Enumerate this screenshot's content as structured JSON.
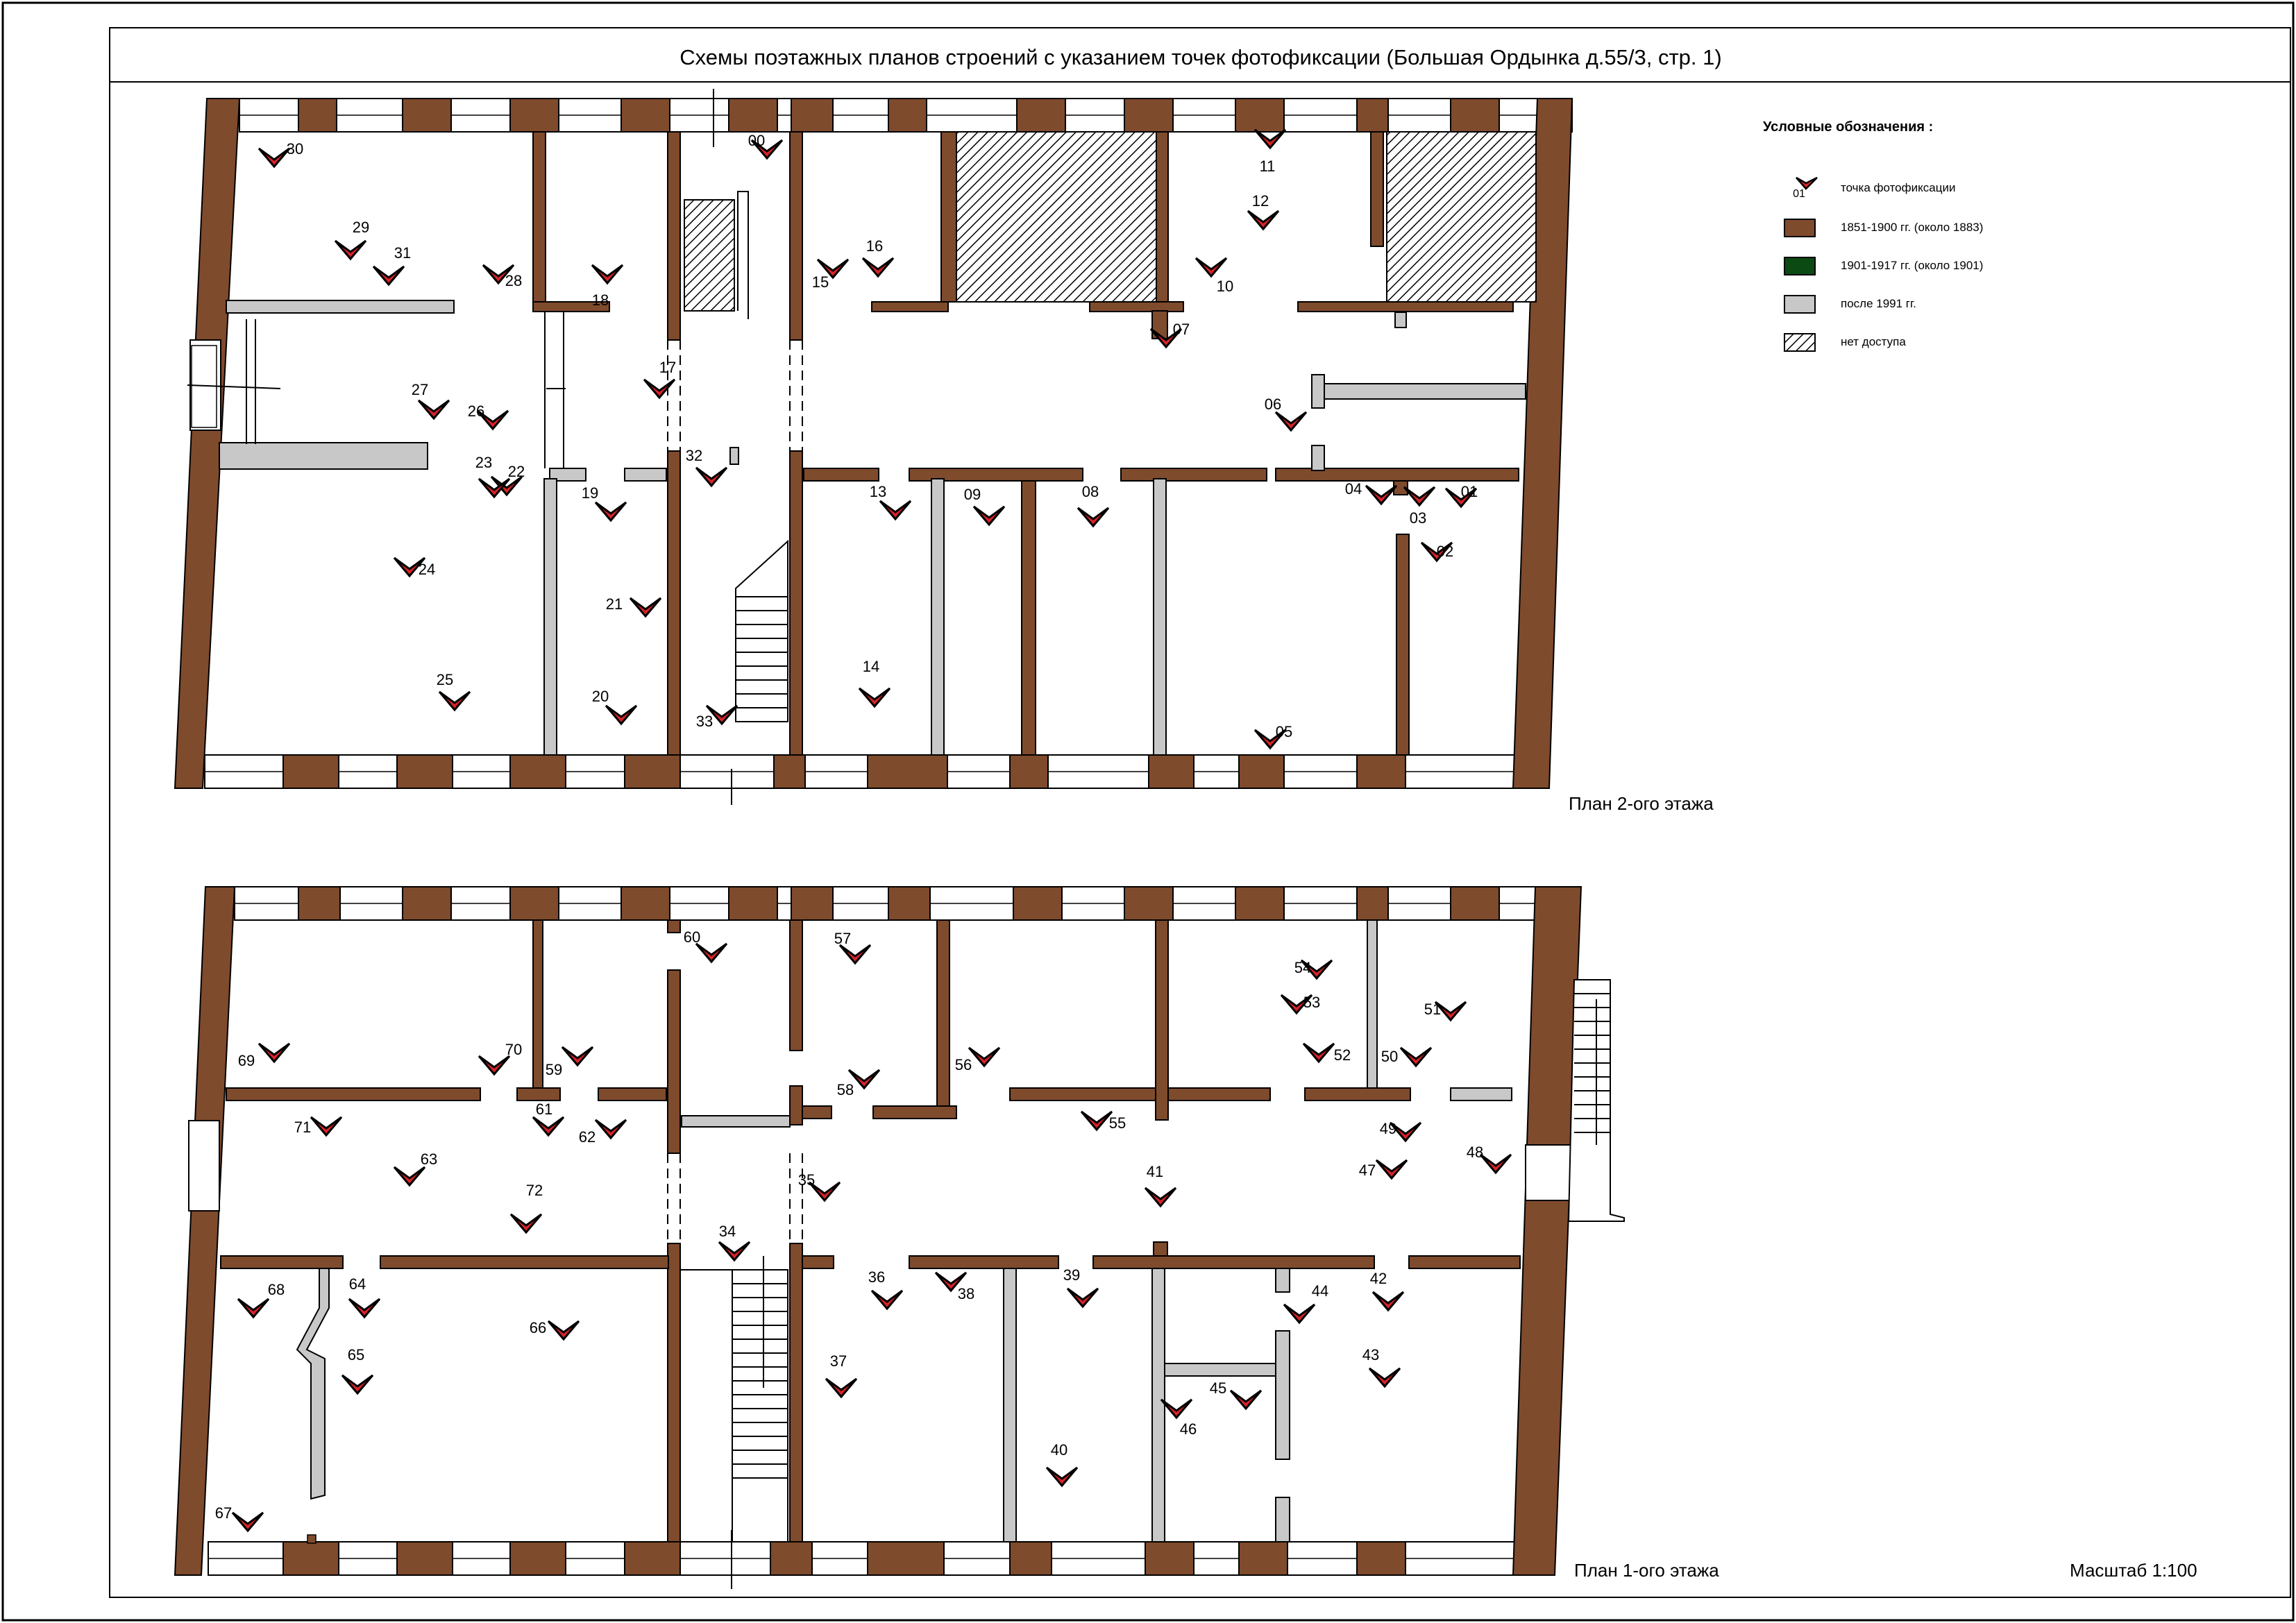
{
  "title": "Схемы поэтажных планов строений с указанием точек фотофиксации (Большая Ордынка д.55/3, стр. 1)",
  "legend": {
    "title": "Условные обозначения :",
    "items": [
      {
        "kind": "marker",
        "code": "01",
        "label": "точка фотофиксации"
      },
      {
        "kind": "swatch",
        "color": "#7f4b2d",
        "label": "1851-1900 гг. (около 1883)"
      },
      {
        "kind": "swatch",
        "color": "#0b4a12",
        "label": "1901-1917 гг. (около 1901)"
      },
      {
        "kind": "swatch",
        "color": "#c8c8c8",
        "label": "после 1991 гг."
      },
      {
        "kind": "hatch",
        "label": "нет доступа"
      }
    ]
  },
  "colors": {
    "wall_old": "#7f4b2d",
    "wall_new": "#c8c8c8",
    "marker_red": "#d8232a",
    "line": "#000000"
  },
  "plans": {
    "floor2": {
      "label": "План 2-ого этажа"
    },
    "floor1": {
      "label": "План 1-ого этажа"
    }
  },
  "scale": "Масштаб 1:100",
  "photo_points": {
    "floor2": [
      "00",
      "01",
      "02",
      "03",
      "04",
      "05",
      "06",
      "07",
      "08",
      "09",
      "10",
      "11",
      "12",
      "13",
      "14",
      "15",
      "16",
      "17",
      "18",
      "19",
      "20",
      "21",
      "22",
      "23",
      "24",
      "25",
      "26",
      "27",
      "28",
      "29",
      "30",
      "31",
      "32",
      "33"
    ],
    "floor1": [
      "34",
      "35",
      "36",
      "37",
      "38",
      "39",
      "40",
      "41",
      "42",
      "43",
      "44",
      "45",
      "46",
      "47",
      "48",
      "49",
      "50",
      "51",
      "52",
      "53",
      "54",
      "55",
      "56",
      "57",
      "58",
      "59",
      "60",
      "61",
      "62",
      "63",
      "64",
      "65",
      "66",
      "67",
      "68",
      "69",
      "70",
      "71",
      "72"
    ]
  }
}
